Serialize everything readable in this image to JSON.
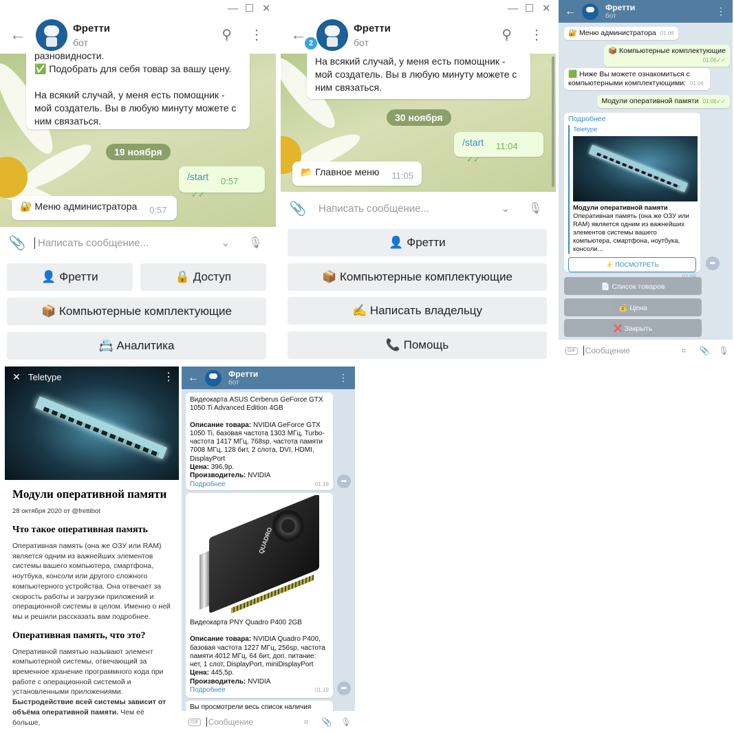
{
  "common": {
    "bot_name": "Фретти",
    "bot_sub": "бот",
    "placeholder_desktop": "Написать сообщение...",
    "placeholder_mobile": "Сообщение"
  },
  "p1": {
    "msg_text1": "разновидности.",
    "msg_text2": "✅ Подобрать для себя товар за вашу цену.",
    "msg_text3": "На всякий случай, у меня есть помощник - мой создатель. Вы в любую минуту можете с ним связаться.",
    "date": "19 ноября",
    "start": "/start",
    "start_time": "0:57",
    "admin": "🔐 Меню администратора",
    "admin_time": "0:57",
    "kb": [
      "👤 Фретти",
      "🔒 Доступ",
      "📦 Компьютерные комплектующие",
      "📇 Аналитика"
    ]
  },
  "p2": {
    "badge": "2",
    "msg_text": "На всякий случай, у меня есть помощник - мой создатель. Вы в любую минуту можете с ним связаться.",
    "date": "30 ноября",
    "start": "/start",
    "start_time": "11:04",
    "menu": "📂 Главное меню",
    "menu_time": "11:05",
    "kb": [
      "👤 Фретти",
      "📦 Компьютерные комплектующие",
      "✍️ Написать владельцу",
      "📞 Помощь"
    ]
  },
  "p3": {
    "m1": "🔐 Меню администратора",
    "m1_time": "01:06",
    "m2": "📦 Компьютерные комплектующие",
    "m2_time": "01:06",
    "m3": "🟩 Ниже Вы можете ознакомиться с компьютерными комплектующими:",
    "m3_time": "01:06",
    "m4": "Модули оперативной памяти",
    "m4_time": "01:06",
    "link": "Подробнее",
    "site": "Teletype",
    "card_title": "Модули оперативной памяти",
    "card_desc": "Оперативная память (она же ОЗУ или RAM) является одним из важнейших элементов системы вашего компьютера, смартфона, ноутбука, консоли...",
    "view_btn": "⚡ ПОСМОТРЕТЬ",
    "card_time": "01:06",
    "kb": [
      "📄 Список товаров",
      "💰 Цена",
      "❌ Закрыть"
    ]
  },
  "p4": {
    "site": "Teletype",
    "title": "Модули оперативной памяти",
    "meta": "28 октября 2020 от @frettibot",
    "h2a": "Что такое оперативная память",
    "pa": "Оперативная память (она же ОЗУ или RAM) является одним из важнейших элементов системы вашего компьютера, смартфона, ноутбука, консоли или другого сложного компьютерного устройства. Она отвечает за скорость работы и загрузки приложений и операционной системы в целом. Именно о ней мы и решили рассказать вам подробнее.",
    "h2b": "Оперативная память, что это?",
    "pb": "Оперативной памятью называют элемент компьютерной системы, отвечающий за временное хранение программного кода при работе с операционной системой и установленными приложениями.",
    "pc_bold": "Быстродействие всей системы зависит от объёма оперативной памяти.",
    "pc": " Чем её больше,"
  },
  "p5": {
    "c1_name": "Видеокарта ASUS Cerberus GeForce GTX 1050 Ti Advanced Edition 4GB",
    "c1_desc_label": "Описание товара:",
    "c1_desc": " NVIDIA GeForce GTX 1050 Ti, базовая частота 1303 МГц, Turbo-частота 1417 МГц, 768sp, частота памяти 7008 МГц, 128 бит, 2 слота, DVI, HDMI, DisplayPort",
    "price_label": "Цена:",
    "c1_price": " 396,9р.",
    "maker_label": "Производитель:",
    "c1_maker": " NVIDIA",
    "more": "Подробнее",
    "c1_time": "01:19",
    "c2_name": "Видеокарта PNY Quadro P400 2GB",
    "c2_desc_label": "Описание товара:",
    "c2_desc": " NVIDIA Quadro P400, базовая частота 1227 МГц, 256sp, частота памяти 4012 МГц, 64 бит, доп. питание: нет, 1 слот, DisplayPort, miniDisplayPort",
    "c2_price": " 445,5р.",
    "c2_maker": " NVIDIA",
    "c2_time": "01:19",
    "c3": "Вы просмотрели весь список наличия",
    "card_brand": "QUADRO"
  }
}
